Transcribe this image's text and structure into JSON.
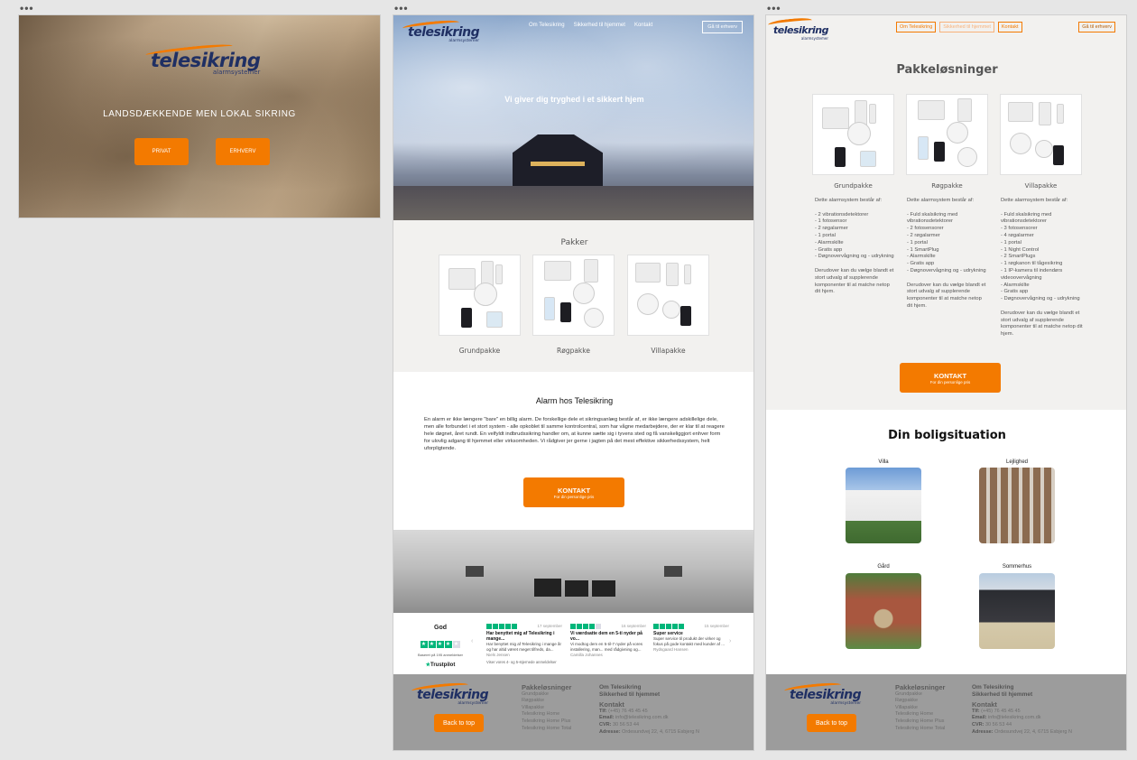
{
  "board1": {
    "title": "LANDSDÆKKENDE MEN LOKAL SIKRING",
    "btn_privat": "PRIVAT",
    "btn_erhverv": "ERHVERV"
  },
  "logo": {
    "word": "telesikring",
    "sub": "alarmsystemer"
  },
  "board2": {
    "nav": [
      "Om Telesikring",
      "Sikkerhed til hjemmet",
      "Kontakt"
    ],
    "nav_button": "Gå til erhverv",
    "hero_tagline": "Vi giver dig tryghed i et sikkert hjem",
    "pakker_title": "Pakker",
    "products": [
      "Grundpakke",
      "Røgpakke",
      "Villapakke"
    ],
    "alarm_title": "Alarm hos Telesikring",
    "alarm_text": "En alarm er ikke længere \"bare\" en billig alarm. De forskellige dele et sikringsanlæg består af, er ikke længere adskillelige dele, men alle forbundet i et stort system - alle opkoblet til samme kontrolcentral, som har vågne medarbejdere, der er klar til at reagere hele døgnet, året rundt. En velfyldt indbrudssikring handler om, at kunne sætte sig i tyvens sted og få vanskeliggjort enhver form for ulovlig adgang til hjemmet eller virksomheden. Vi rådgiver jer gerne i jagten på det mest effektive sikkerhedssystem, helt uforpligtende.",
    "kontakt_label": "KONTAKT",
    "kontakt_sub": "For din personlige pris",
    "trustpilot": {
      "rating_word": "God",
      "based_on": "Baseret på 195 anmeldelser",
      "brand": "Trustpilot",
      "shows": "Viser vores 4- og 5-stjernede anmeldelser",
      "reviews": [
        {
          "title": "Har benyttet mig af Telesikring i mange...",
          "text": "Har benyttet mig af Telesikring i mange år og har altid været meget tilfreds, da...",
          "author": "Niels Jensen",
          "date": "17 september"
        },
        {
          "title": "Vi værdsatte dem en 5-ti nyder på vo...",
          "text": "Vi modtog dem en 5-til-7 nyder på vores installering, man... med rådgivning og...",
          "author": "Camilla Johannes",
          "date": "16 september"
        },
        {
          "title": "Super service",
          "text": "Super service til produkt der virker og fokus på gode kontakt med kunder af ...",
          "author": "Rydsgaard Hansen",
          "date": "15 september"
        }
      ]
    }
  },
  "footer": {
    "back_to_top": "Back to top",
    "col1_title": "Pakkeløsninger",
    "col1_items": [
      "Grundpakke",
      "Røgpakke",
      "Villapakke",
      "Telesikring Home",
      "Telesikring Home Plus",
      "Telesikring Home Total"
    ],
    "col2_links": [
      "Om Telesikring",
      "Sikkerhed til hjemmet"
    ],
    "col2_title": "Kontakt",
    "tlf_label": "Tlf:",
    "tlf": "(+45) 76 45 45 45",
    "email_label": "Email:",
    "email": "info@telesikring.com.dk",
    "cvr_label": "CVR:",
    "cvr": "30 56 53 44",
    "adresse_label": "Adresse:",
    "adresse": "Ordesundvej 22, 4, 6715 Esbjerg N"
  },
  "board3": {
    "nav": [
      "Om Telesikring",
      "Sikkerhed til hjemmet",
      "Kontakt"
    ],
    "nav_button": "Gå til erhverv",
    "title": "Pakkeløsninger",
    "packages": [
      {
        "name": "Grundpakke",
        "intro": "Dette alarmsystem består af:",
        "items": [
          "- 2 vibrationsdetektorer",
          "- 1 fotosensor",
          "- 2 røgalarmer",
          "- 1 portal",
          "- Alarmskilte",
          "- Gratis app",
          "- Døgnovervågning og - udrykning"
        ],
        "note": "Derudover kan du vælge blandt et stort udvalg af supplerende komponenter til at matche netop dit hjem."
      },
      {
        "name": "Røgpakke",
        "intro": "Dette alarmsystem består af:",
        "items": [
          "- Fuld skalsikring med vibrationsdetektorer",
          "- 2 fotosensorer",
          "- 2 røgalarmer",
          "- 1 portal",
          "- 1 SmartPlug",
          "- Alarmskilte",
          "- Gratis app",
          "- Døgnovervågning og - udrykning"
        ],
        "note": "Derudover kan du vælge blandt et stort udvalg af supplerende komponenter til at matche netop dit hjem."
      },
      {
        "name": "Villapakke",
        "intro": "Dette alarmsystem består af:",
        "items": [
          "- Fuld skalsikring med vibrationsdetektorer",
          "- 3 fotosensorer",
          "- 4 røgalarmer",
          "- 1 portal",
          "- 1 Night Control",
          "- 2 SmartPlugs",
          "- 1 røgkanon til tågesikring",
          "- 1 IP-kamera til indendørs videoovervågning",
          "- Alarmskilte",
          "- Gratis app",
          "- Døgnovervågning og - udrykning"
        ],
        "note": "Derudover kan du vælge blandt et stort udvalg af supplerende komponenter til at matche netop dit hjem."
      }
    ],
    "kontakt_label": "KONTAKT",
    "kontakt_sub": "For din personlige pris",
    "bolig_title": "Din boligsituation",
    "bolig": [
      "Villa",
      "Lejlighed",
      "Gård",
      "Sommerhus"
    ]
  }
}
